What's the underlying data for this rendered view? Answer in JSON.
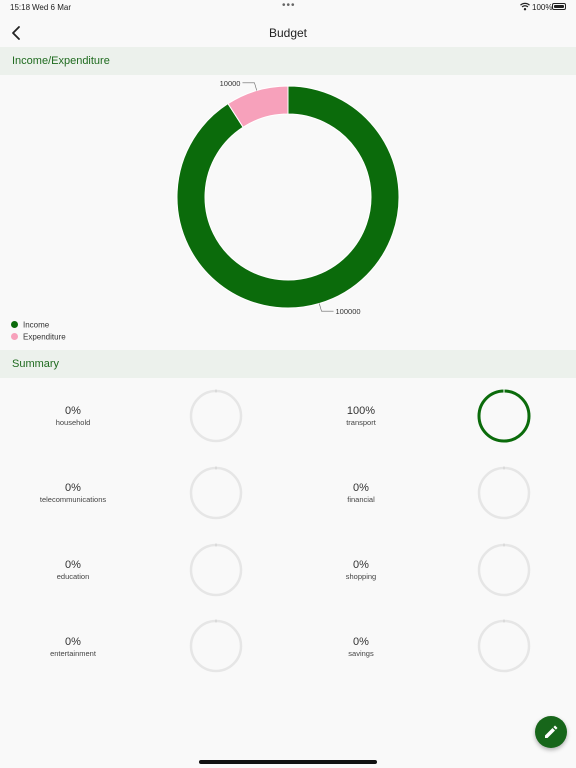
{
  "status": {
    "time": "15:18",
    "date": "Wed 6 Mar",
    "battery": "100%"
  },
  "nav": {
    "title": "Budget",
    "back_icon": "chevron-left-icon"
  },
  "sections": {
    "income_title": "Income/Expenditure",
    "summary_title": "Summary"
  },
  "colors": {
    "income": "#0b6b0b",
    "expenditure": "#f7a1bb",
    "ring_track": "#e6e6e6",
    "accent": "#17661a"
  },
  "chart_data": {
    "type": "pie",
    "categories": [
      "Income",
      "Expenditure"
    ],
    "values": [
      100000,
      10000
    ],
    "labels": [
      "100000",
      "10000"
    ],
    "title": ""
  },
  "legend": [
    {
      "label": "Income"
    },
    {
      "label": "Expenditure"
    }
  ],
  "categories": [
    {
      "pct_text": "0%",
      "name": "household",
      "fraction": 0
    },
    {
      "pct_text": "100%",
      "name": "transport",
      "fraction": 1
    },
    {
      "pct_text": "0%",
      "name": "telecommunications",
      "fraction": 0
    },
    {
      "pct_text": "0%",
      "name": "financial",
      "fraction": 0
    },
    {
      "pct_text": "0%",
      "name": "education",
      "fraction": 0
    },
    {
      "pct_text": "0%",
      "name": "shopping",
      "fraction": 0
    },
    {
      "pct_text": "0%",
      "name": "entertainment",
      "fraction": 0
    },
    {
      "pct_text": "0%",
      "name": "savings",
      "fraction": 0
    }
  ],
  "fab": {
    "icon": "pencil-icon"
  }
}
